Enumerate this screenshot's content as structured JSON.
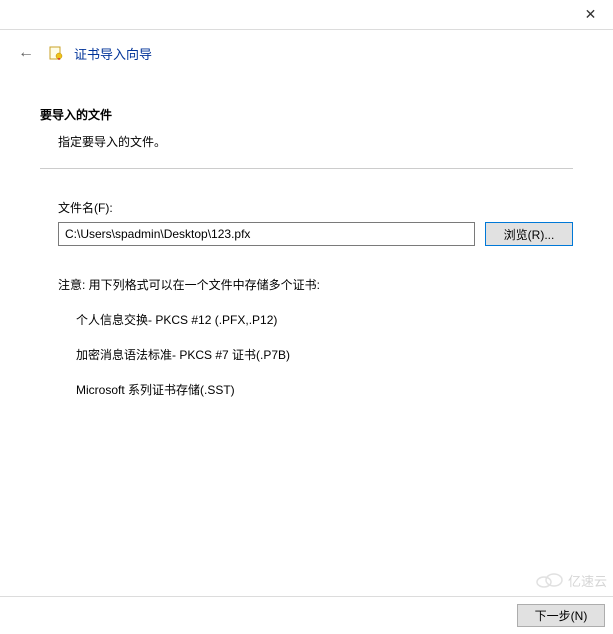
{
  "titlebar": {
    "close_icon": "✕"
  },
  "header": {
    "back_icon": "←",
    "wizard_title": "证书导入向导"
  },
  "main": {
    "section_title": "要导入的文件",
    "section_subtitle": "指定要导入的文件。",
    "file_label": "文件名(F):",
    "file_value": "C:\\Users\\spadmin\\Desktop\\123.pfx",
    "browse_label": "浏览(R)...",
    "note": "注意: 用下列格式可以在一个文件中存储多个证书:",
    "formats": [
      "个人信息交换- PKCS #12 (.PFX,.P12)",
      "加密消息语法标准- PKCS #7 证书(.P7B)",
      "Microsoft 系列证书存储(.SST)"
    ]
  },
  "footer": {
    "next_label": "下一步(N)"
  },
  "watermark": {
    "text": "亿速云"
  }
}
